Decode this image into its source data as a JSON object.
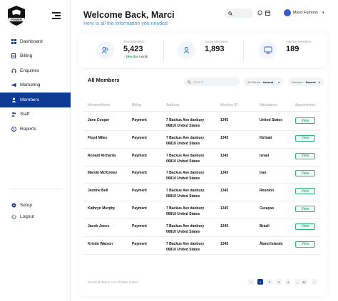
{
  "brand": {
    "logo_text": "POWER"
  },
  "sidebar": {
    "items": [
      {
        "label": "Dashboard",
        "icon": "grid-icon"
      },
      {
        "label": "Billing",
        "icon": "document-icon"
      },
      {
        "label": "Enquiries",
        "icon": "headset-icon"
      },
      {
        "label": "Marketing",
        "icon": "megaphone-icon"
      },
      {
        "label": "Members",
        "icon": "members-icon",
        "active": true
      },
      {
        "label": "Staff",
        "icon": "staff-icon"
      },
      {
        "label": "Reports",
        "icon": "reports-icon"
      }
    ],
    "bottom": [
      {
        "label": "Setup",
        "icon": "gear-icon"
      },
      {
        "label": "Logout",
        "icon": "logout-icon"
      }
    ]
  },
  "header": {
    "title": "Welcome Back, Marci",
    "subtitle": "Here is all the information you needed",
    "user_name": "Marci Fumons"
  },
  "stats": [
    {
      "label": "Total Members",
      "value": "5,423",
      "trend": "16%",
      "trend_suffix": " this month"
    },
    {
      "label": "Active Members",
      "value": "1,893"
    },
    {
      "label": "Inactive Members",
      "value": "189"
    }
  ],
  "table": {
    "title": "All Members",
    "search_placeholder": "Search",
    "filter1_label": "All Clients :",
    "filter1_value": "Newest",
    "filter2_label": "Services :",
    "filter2_value": "Newest",
    "columns": [
      "MemberName",
      "Billing",
      "Address",
      "Member ID",
      "Attendance",
      "Appointment"
    ],
    "rows": [
      {
        "name": "Jane Cooper",
        "billing": "Payment",
        "address1": "7 Backus Ave danbury",
        "address2": "06810 United States",
        "id": "1345",
        "attendance": "United States",
        "action": "View"
      },
      {
        "name": "Floyd Miles",
        "billing": "Payment",
        "address1": "7 Backus Ave danbury",
        "address2": "06810 United States",
        "id": "1345",
        "attendance": "Kiribati",
        "action": "View"
      },
      {
        "name": "Ronald Richards",
        "billing": "Payment",
        "address1": "7 Backus Ave danbury",
        "address2": "06810 United States",
        "id": "1345",
        "attendance": "Israel",
        "action": "View"
      },
      {
        "name": "Marvin McKinney",
        "billing": "Payment",
        "address1": "7 Backus Ave danbury",
        "address2": "06810 United States",
        "id": "1345",
        "attendance": "Iran",
        "action": "View"
      },
      {
        "name": "Jerome Bell",
        "billing": "Payment",
        "address1": "7 Backus Ave danbury",
        "address2": "06810 United States",
        "id": "1345",
        "attendance": "Réunion",
        "action": "View"
      },
      {
        "name": "Kathryn Murphy",
        "billing": "Payment",
        "address1": "7 Backus Ave danbury",
        "address2": "06810 United States",
        "id": "1345",
        "attendance": "Curaçao",
        "action": "View"
      },
      {
        "name": "Jacob Jones",
        "billing": "Payment",
        "address1": "7 Backus Ave danbury",
        "address2": "06810 United States",
        "id": "1345",
        "attendance": "Brazil",
        "action": "View"
      },
      {
        "name": "Kristin Watson",
        "billing": "Payment",
        "address1": "7 Backus Ave danbury",
        "address2": "06810 United States",
        "id": "1345",
        "attendance": "Åland Islands",
        "action": "View"
      }
    ],
    "footer_text": "Showing data 1 to 8 of 256K entries",
    "pagination": [
      "‹",
      "1",
      "2",
      "3",
      "4",
      "...",
      "40",
      "›"
    ],
    "active_page": "1"
  },
  "colors": {
    "primary": "#0d3b94",
    "accent_blue": "#4a8ec9",
    "success": "#2fb67c"
  }
}
